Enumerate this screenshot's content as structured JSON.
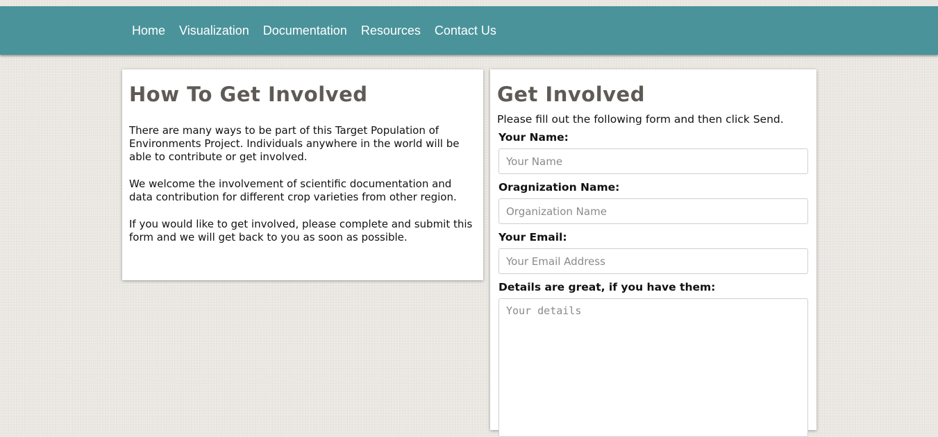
{
  "nav": {
    "items": [
      {
        "label": "Home"
      },
      {
        "label": "Visualization"
      },
      {
        "label": "Documentation"
      },
      {
        "label": "Resources"
      },
      {
        "label": "Contact Us"
      }
    ]
  },
  "left_panel": {
    "title": "How To Get Involved",
    "paragraphs": [
      "There are many ways to be part of this Target Population of Environments Project. Individuals anywhere in the world will be able to contribute or get involved.",
      "We welcome the involvement of scientific documentation and data contribution for different crop varieties from other region.",
      "If you would like to get involved, please complete and submit this form and we will get back to you as soon as possible."
    ]
  },
  "form": {
    "title": "Get Involved",
    "intro": "Please fill out the following form and then click Send.",
    "name": {
      "label": "Your Name:",
      "placeholder": "Your Name",
      "value": ""
    },
    "organization": {
      "label": "Oragnization Name:",
      "placeholder": "Organization Name",
      "value": ""
    },
    "email": {
      "label": "Your Email:",
      "placeholder": "Your Email Address",
      "value": ""
    },
    "details": {
      "label": "Details are great, if you have them:",
      "placeholder": "Your details",
      "value": ""
    }
  },
  "colors": {
    "navbar": "#4a939a",
    "heading": "#5e5a55",
    "background": "#ebe8e3"
  }
}
